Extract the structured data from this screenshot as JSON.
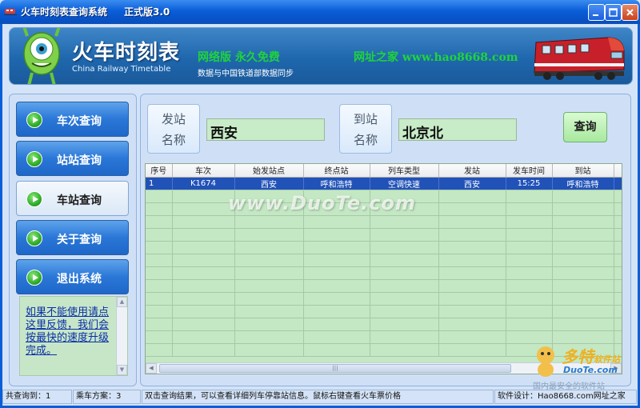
{
  "window": {
    "title": "火车时刻表查询系统",
    "version": "正式版3.0"
  },
  "banner": {
    "title": "火车时刻表",
    "subtitle": "China Railway Timetable",
    "slogan": "网络版 永久免费",
    "site": "网址之家 www.hao8668.com",
    "sync_note": "数据与中国铁道部数据同步"
  },
  "nav": {
    "items": [
      {
        "label": "车次查询",
        "active": false
      },
      {
        "label": "站站查询",
        "active": false
      },
      {
        "label": "车站查询",
        "active": true
      },
      {
        "label": "关于查询",
        "active": false
      },
      {
        "label": "退出系统",
        "active": false
      }
    ],
    "feedback_link": "如果不能使用请点这里反馈，我们会按最快的速度升级完成。"
  },
  "search": {
    "from_label_1": "发站",
    "from_label_2": "名称",
    "from_value": "西安",
    "to_label_1": "到站",
    "to_label_2": "名称",
    "to_value": "北京北",
    "query_button": "查询"
  },
  "table": {
    "columns": [
      "序号",
      "车次",
      "始发站点",
      "终点站",
      "列车类型",
      "发站",
      "发车时间",
      "到站"
    ],
    "rows": [
      [
        "1",
        "K1674",
        "西安",
        "呼和浩特",
        "空调快速",
        "西安",
        "15:25",
        "呼和浩特"
      ]
    ]
  },
  "watermark": {
    "text": "www.DuoTe.com",
    "logo_cn": "多特",
    "logo_cn_small": "软件站",
    "logo_en": "DuoTe.com",
    "logo_caption": "国内最安全的软件站"
  },
  "status": {
    "found": "共查询到：1",
    "plans": "乘车方案：3",
    "hint": "双击查询结果，可以查看详细列车停靠站信息。鼠标右键查看火车票价格",
    "designer": "软件设计：Hao8668.com网址之家"
  },
  "colors": {
    "titlebar": "#0a5ed8",
    "nav_button": "#2a77d8",
    "grid_bg": "#c3e8c3",
    "selection": "#2152b8",
    "slogan": "#1fd43a"
  }
}
